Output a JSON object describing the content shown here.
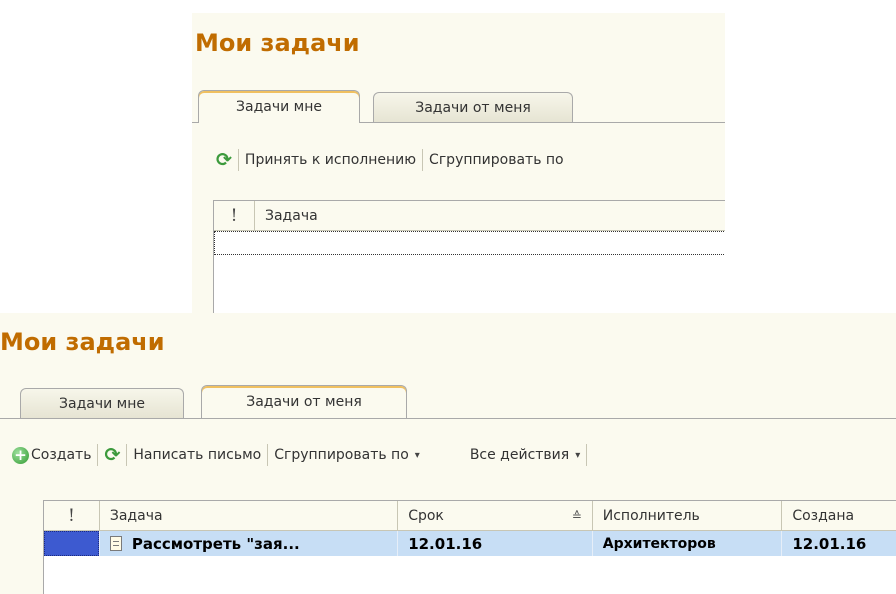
{
  "top_form": {
    "title": "Мои задачи",
    "tabs": [
      {
        "label": "Задачи мне",
        "active": true
      },
      {
        "label": "Задачи от меня",
        "active": false
      }
    ],
    "toolbar": {
      "refresh_icon": "refresh-icon",
      "accept_label": "Принять к исполнению",
      "group_label": "Сгруппировать по"
    },
    "grid": {
      "columns": [
        "!",
        "Задача"
      ]
    }
  },
  "bottom_form": {
    "title": "Мои задачи",
    "tabs": [
      {
        "label": "Задачи мне",
        "active": false
      },
      {
        "label": "Задачи от меня",
        "active": true
      }
    ],
    "toolbar": {
      "create_icon": "plus-circle-icon",
      "create_label": "Создать",
      "refresh_icon": "refresh-icon",
      "write_letter_label": "Написать письмо",
      "group_label": "Сгруппировать по",
      "all_actions_label": "Все действия",
      "dropdown_glyph": "▾"
    },
    "grid": {
      "columns": [
        "!",
        "Задача",
        "Срок",
        "Исполнитель",
        "Создана"
      ],
      "sort_indicator": "≙",
      "rows": [
        {
          "task": "Рассмотреть \"зая...",
          "due": "12.01.16",
          "executor": "Архитекторов",
          "created": "12.01.16",
          "selected": true
        }
      ]
    }
  },
  "colors": {
    "title": "#c06c00",
    "panel_bg": "#fbfaef",
    "selection": "#c7def5",
    "marker": "#3d5ad0"
  }
}
